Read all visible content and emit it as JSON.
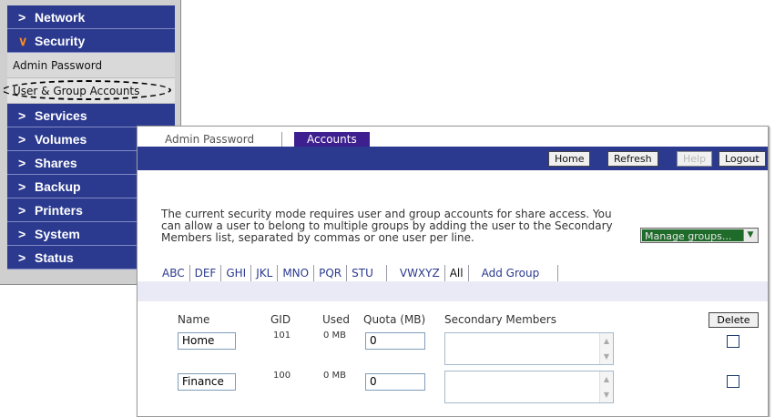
{
  "sidebar": {
    "items": [
      {
        "label": "Network"
      },
      {
        "label": "Security"
      },
      {
        "label": "Services"
      },
      {
        "label": "Volumes"
      },
      {
        "label": "Shares"
      },
      {
        "label": "Backup"
      },
      {
        "label": "Printers"
      },
      {
        "label": "System"
      },
      {
        "label": "Status"
      }
    ],
    "security_subitems": [
      {
        "label": "Admin Password"
      },
      {
        "label": "User & Group Accounts"
      }
    ]
  },
  "tabs": {
    "admin_password": "Admin Password",
    "accounts": "Accounts"
  },
  "toolbar": {
    "home": "Home",
    "refresh": "Refresh",
    "help": "Help",
    "logout": "Logout"
  },
  "description": "The current security mode requires user and group accounts for share access. You can allow a user to belong to multiple groups by adding the user to the Secondary Members list, separated by commas or one user per line.",
  "manage_select": {
    "value": "Manage groups..."
  },
  "letter_filters": [
    "ABC",
    "DEF",
    "GHI",
    "JKL",
    "MNO",
    "PQR",
    "STU",
    "VWXYZ",
    "All"
  ],
  "add_group": "Add Group",
  "table": {
    "headers": {
      "name": "Name",
      "gid": "GID",
      "used": "Used",
      "quota": "Quota (MB)",
      "secondary": "Secondary Members"
    },
    "delete_label": "Delete",
    "rows": [
      {
        "name": "Home",
        "gid": "101",
        "used": "0 MB",
        "quota": "0"
      },
      {
        "name": "Finance",
        "gid": "100",
        "used": "0 MB",
        "quota": "0"
      }
    ]
  },
  "colors": {
    "nav_blue": "#2b3a8f",
    "accounts_tab": "#3e1f8f",
    "manage_green": "#1e6b2a",
    "chevron_open": "#ff8c1a"
  }
}
